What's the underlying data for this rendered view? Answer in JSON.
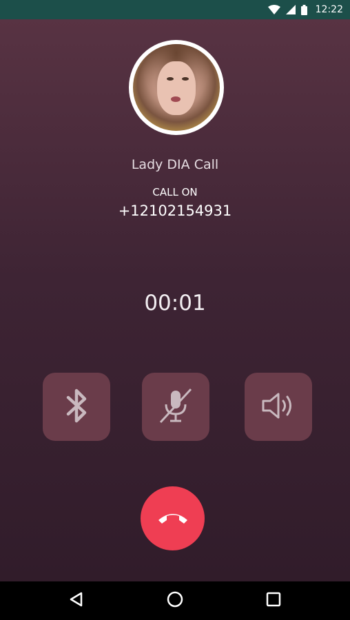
{
  "status_bar": {
    "time": "12:22",
    "background": "#1c4f4a",
    "icons": [
      "wifi-icon",
      "cell-signal-icon",
      "battery-icon"
    ]
  },
  "caller": {
    "name": "Lady DIA Call",
    "status": "CALL ON",
    "number": "+12102154931",
    "avatar": "caller-avatar-photo"
  },
  "timer": "00:01",
  "controls": [
    {
      "name": "bluetooth-button",
      "icon": "bluetooth-icon"
    },
    {
      "name": "mute-button",
      "icon": "mic-off-icon"
    },
    {
      "name": "speaker-button",
      "icon": "speaker-icon"
    }
  ],
  "end_call": {
    "icon": "hangup-phone-icon",
    "color": "#ef3e53"
  },
  "nav_bar": {
    "icons": [
      "back-icon",
      "home-icon",
      "recents-icon"
    ]
  }
}
